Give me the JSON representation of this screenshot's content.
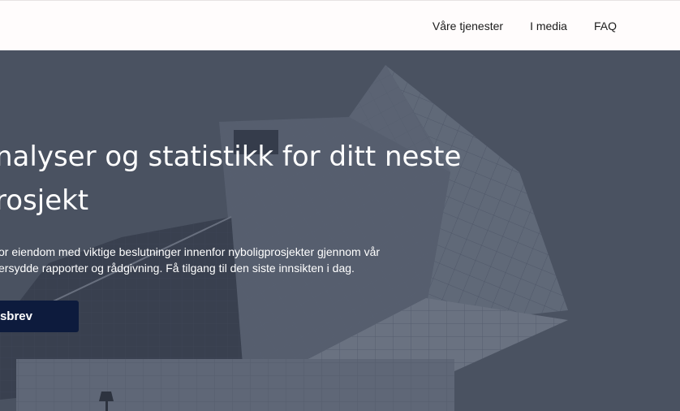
{
  "header": {
    "nav": [
      {
        "label": "Våre tjenester"
      },
      {
        "label": "I media"
      },
      {
        "label": "FAQ"
      }
    ]
  },
  "hero": {
    "title_line_1": "nalyser og statistikk for ditt neste",
    "title_line_2": "rosjekt",
    "description_line_1": "or eiendom med viktige beslutninger innenfor nyboligprosjekter gjennom vår",
    "description_line_2": "ersydde rapporter og rådgivning. Få tilgang til den siste innsikten i dag.",
    "cta_label": "tsbrev",
    "background_image": "building-icon",
    "overlay_color": "#4e5563",
    "cta_color": "#0d1b3d"
  }
}
